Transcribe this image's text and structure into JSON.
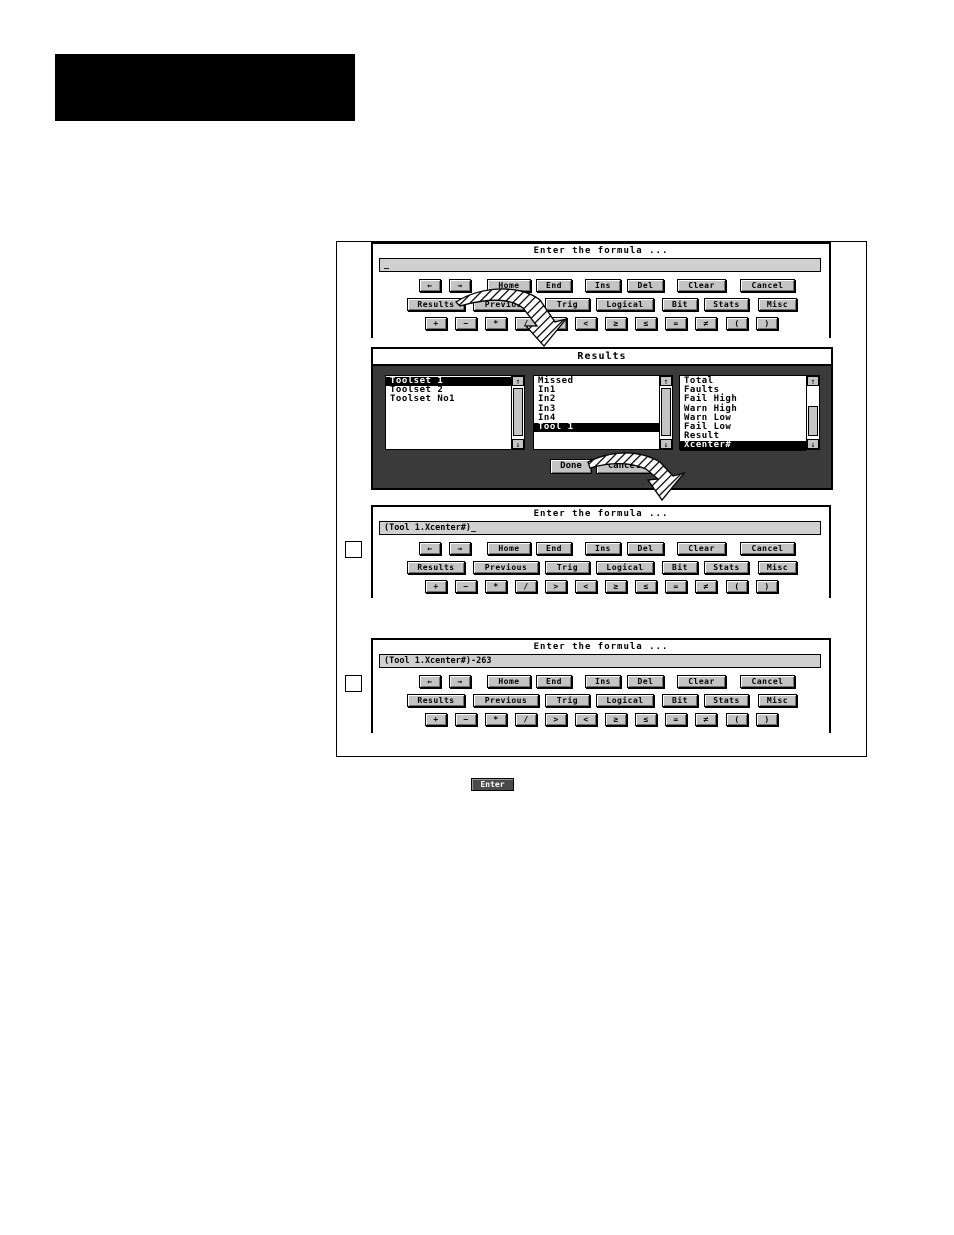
{
  "formula_title": "Enter the formula ...",
  "nav_buttons": [
    "←",
    "→",
    "Home",
    "End",
    "Ins",
    "Del",
    "Clear",
    "Cancel"
  ],
  "category_buttons": [
    "Results",
    "Previous",
    "Trig",
    "Logical",
    "Bit",
    "Stats",
    "Misc"
  ],
  "operator_buttons": [
    "+",
    "−",
    "*",
    "/",
    ">",
    "<",
    "≥",
    "≤",
    "=",
    "≠",
    "(",
    ")"
  ],
  "panels": [
    {
      "formula_value": "_"
    },
    {
      "formula_value": "(Tool 1.Xcenter#)_"
    },
    {
      "formula_value": "(Tool 1.Xcenter#)-263"
    }
  ],
  "results_dialog": {
    "title": "Results",
    "toolsets": [
      "Toolset 1",
      "Toolset 2",
      "Toolset No1"
    ],
    "tools": [
      "Missed",
      "In1",
      "In2",
      "In3",
      "In4",
      "Tool 1"
    ],
    "results": [
      "Total",
      "Faults",
      "Fail High",
      "Warn High",
      "Warn Low",
      "Fail Low",
      "Result",
      "Xcenter#"
    ],
    "selected_toolset": 0,
    "selected_tool": 5,
    "selected_result": 7,
    "done_label": "Done",
    "cancel_label": "Cancel",
    "scroll_up_icon": "↑",
    "scroll_down_icon": "↓"
  },
  "enter_key_label": "Enter"
}
